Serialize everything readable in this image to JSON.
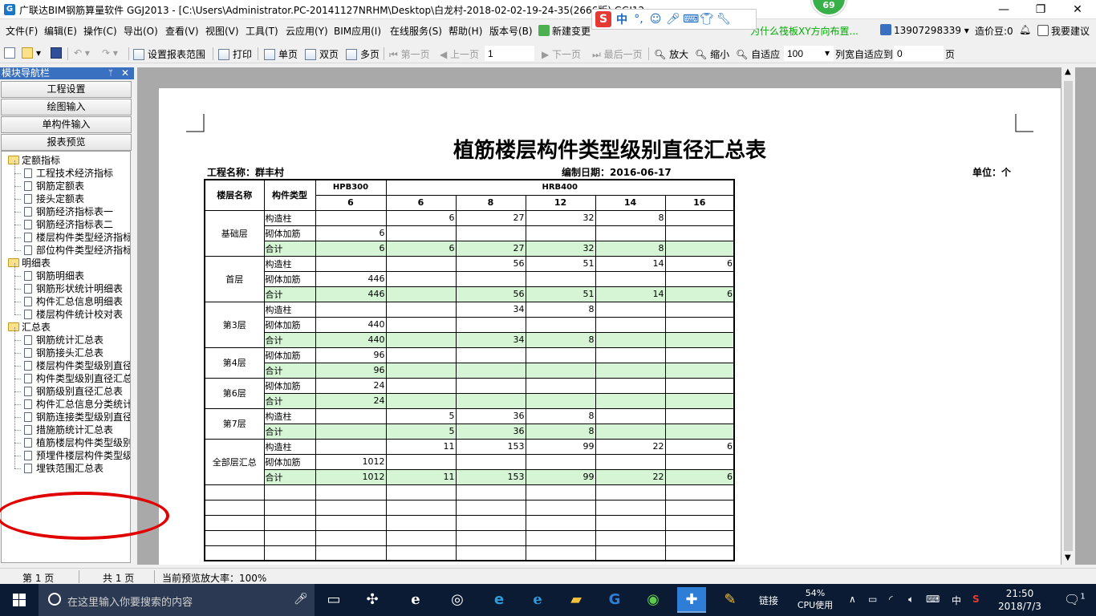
{
  "window": {
    "app_icon": "app-icon",
    "title": "广联达BIM钢筋算量软件 GGJ2013 - [C:\\Users\\Administrator.PC-20141127NRHM\\Desktop\\白龙村-2018-02-02-19-24-35(2666版).GGJ12]",
    "badge": "69",
    "ime": {
      "logo": "S",
      "mode": "中"
    },
    "controls": {
      "minimize": "—",
      "maximize": "❐",
      "close": "✕"
    }
  },
  "menu": {
    "items": [
      "文件(F)",
      "编辑(E)",
      "操作(C)",
      "导出(O)",
      "查看(V)",
      "视图(V)",
      "工具(T)",
      "云应用(Y)",
      "BIM应用(I)",
      "在线服务(S)",
      "帮助(H)",
      "版本号(B)"
    ],
    "new_change": "新建变更",
    "question": "为什么筏板XY方向布置...",
    "phone": "13907298339",
    "price_beans": "造价豆:0",
    "suggest": "我要建议"
  },
  "toolbar": {
    "set_range": "设置报表范围",
    "print": "打印",
    "single_page": "单页",
    "double_page": "双页",
    "multi_page": "多页",
    "first_page": "第一页",
    "prev_page": "上一页",
    "page_input": "1",
    "next_page": "下一页",
    "last_page": "最后一页",
    "zoom_in": "放大",
    "zoom_out": "缩小",
    "fit": "自适应",
    "zoom_value": "100",
    "col_fit": "列宽自适应到",
    "col_fit_value": "0",
    "page_unit": "页"
  },
  "left_panel": {
    "title": "模块导航栏",
    "pin": "ᛘ",
    "close": "✕",
    "nav_buttons": [
      "工程设置",
      "绘图输入",
      "单构件输入",
      "报表预览"
    ],
    "tree": [
      {
        "type": "folder",
        "label": "定额指标"
      },
      {
        "type": "doc",
        "label": "工程技术经济指标"
      },
      {
        "type": "doc",
        "label": "钢筋定额表"
      },
      {
        "type": "doc",
        "label": "接头定额表"
      },
      {
        "type": "doc",
        "label": "钢筋经济指标表一"
      },
      {
        "type": "doc",
        "label": "钢筋经济指标表二"
      },
      {
        "type": "doc",
        "label": "楼层构件类型经济指标表"
      },
      {
        "type": "doc",
        "label": "部位构件类型经济指标表"
      },
      {
        "type": "folder",
        "label": "明细表"
      },
      {
        "type": "doc",
        "label": "钢筋明细表"
      },
      {
        "type": "doc",
        "label": "钢筋形状统计明细表"
      },
      {
        "type": "doc",
        "label": "构件汇总信息明细表"
      },
      {
        "type": "doc",
        "label": "楼层构件统计校对表"
      },
      {
        "type": "folder",
        "label": "汇总表"
      },
      {
        "type": "doc",
        "label": "钢筋统计汇总表"
      },
      {
        "type": "doc",
        "label": "钢筋接头汇总表"
      },
      {
        "type": "doc",
        "label": "楼层构件类型级别直径汇总表"
      },
      {
        "type": "doc",
        "label": "构件类型级别直径汇总表"
      },
      {
        "type": "doc",
        "label": "钢筋级别直径汇总表"
      },
      {
        "type": "doc",
        "label": "构件汇总信息分类统计表"
      },
      {
        "type": "doc",
        "label": "钢筋连接类型级别直径汇总表"
      },
      {
        "type": "doc",
        "label": "措施筋统计汇总表"
      },
      {
        "type": "doc",
        "label": "植筋楼层构件类型级别直径汇总表"
      },
      {
        "type": "doc",
        "label": "预埋件楼层构件类型级别直径汇总表"
      },
      {
        "type": "doc",
        "label": "埋铁范围汇总表"
      }
    ],
    "scroll_left": "‹",
    "scroll_right": "›"
  },
  "report": {
    "title": "植筋楼层构件类型级别直径汇总表",
    "project_label": "工程名称：群丰村",
    "date_label": "编制日期：2016-06-17",
    "unit_label": "单位：个",
    "headers": {
      "floor": "楼层名称",
      "type": "构件类型",
      "hpb": "HPB300",
      "hrb": "HRB400",
      "hpb_dia": [
        "6"
      ],
      "hrb_dia": [
        "6",
        "8",
        "12",
        "14",
        "16"
      ]
    },
    "groups": [
      {
        "floor": "基础层",
        "rows": [
          {
            "type": "构造柱",
            "sum": false,
            "vals": [
              "",
              "6",
              "27",
              "32",
              "8",
              ""
            ]
          },
          {
            "type": "砌体加筋",
            "sum": false,
            "vals": [
              "6",
              "",
              "",
              "",
              "",
              ""
            ]
          },
          {
            "type": "合计",
            "sum": true,
            "vals": [
              "6",
              "6",
              "27",
              "32",
              "8",
              ""
            ]
          }
        ]
      },
      {
        "floor": "首层",
        "rows": [
          {
            "type": "构造柱",
            "sum": false,
            "vals": [
              "",
              "",
              "56",
              "51",
              "14",
              "6"
            ]
          },
          {
            "type": "砌体加筋",
            "sum": false,
            "vals": [
              "446",
              "",
              "",
              "",
              "",
              ""
            ]
          },
          {
            "type": "合计",
            "sum": true,
            "vals": [
              "446",
              "",
              "56",
              "51",
              "14",
              "6"
            ]
          }
        ]
      },
      {
        "floor": "第3层",
        "rows": [
          {
            "type": "构造柱",
            "sum": false,
            "vals": [
              "",
              "",
              "34",
              "8",
              "",
              ""
            ]
          },
          {
            "type": "砌体加筋",
            "sum": false,
            "vals": [
              "440",
              "",
              "",
              "",
              "",
              ""
            ]
          },
          {
            "type": "合计",
            "sum": true,
            "vals": [
              "440",
              "",
              "34",
              "8",
              "",
              ""
            ]
          }
        ]
      },
      {
        "floor": "第4层",
        "rows": [
          {
            "type": "砌体加筋",
            "sum": false,
            "vals": [
              "96",
              "",
              "",
              "",
              "",
              ""
            ]
          },
          {
            "type": "合计",
            "sum": true,
            "vals": [
              "96",
              "",
              "",
              "",
              "",
              ""
            ]
          }
        ]
      },
      {
        "floor": "第6层",
        "rows": [
          {
            "type": "砌体加筋",
            "sum": false,
            "vals": [
              "24",
              "",
              "",
              "",
              "",
              ""
            ]
          },
          {
            "type": "合计",
            "sum": true,
            "vals": [
              "24",
              "",
              "",
              "",
              "",
              ""
            ]
          }
        ]
      },
      {
        "floor": "第7层",
        "rows": [
          {
            "type": "构造柱",
            "sum": false,
            "vals": [
              "",
              "5",
              "36",
              "8",
              "",
              ""
            ]
          },
          {
            "type": "合计",
            "sum": true,
            "vals": [
              "",
              "5",
              "36",
              "8",
              "",
              ""
            ]
          }
        ]
      },
      {
        "floor": "全部层汇总",
        "rows": [
          {
            "type": "构造柱",
            "sum": false,
            "vals": [
              "",
              "11",
              "153",
              "99",
              "22",
              "6"
            ]
          },
          {
            "type": "砌体加筋",
            "sum": false,
            "vals": [
              "1012",
              "",
              "",
              "",
              "",
              ""
            ]
          },
          {
            "type": "合计",
            "sum": true,
            "vals": [
              "1012",
              "11",
              "153",
              "99",
              "22",
              "6"
            ]
          }
        ]
      }
    ],
    "empty_rows": 5
  },
  "status": {
    "page_no": "第 1 页",
    "total": "共 1 页",
    "zoom": "当前预览放大率：100%"
  },
  "taskbar": {
    "search_placeholder": "在这里输入你要搜索的内容",
    "links_label": "链接",
    "cpu_percent": "54%",
    "cpu_label": "CPU使用",
    "ime_lang": "中",
    "time": "21:50",
    "date": "2018/7/3",
    "notification_count": "1"
  },
  "colors": {
    "sum_row": "#d5f5d5",
    "panel_head": "#3a70c0",
    "highlight_circle": "#e00000",
    "taskbar": "#0a1b33"
  }
}
